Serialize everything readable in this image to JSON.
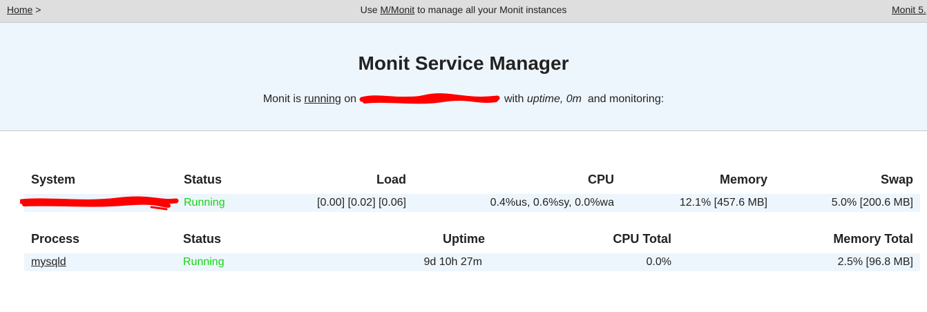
{
  "nav": {
    "home_label": "Home",
    "separator": ">",
    "center_prefix": "Use",
    "center_link": "M/Monit",
    "center_suffix": "to manage all your Monit instances",
    "version_link": "Monit 5."
  },
  "header": {
    "title": "Monit Service Manager",
    "status_prefix": "Monit is",
    "status_link": "running",
    "status_on": "on",
    "status_with": "with",
    "uptime_text": "uptime, 0m",
    "status_suffix": "and monitoring:"
  },
  "system_table": {
    "headers": {
      "system": "System",
      "status": "Status",
      "load": "Load",
      "cpu": "CPU",
      "memory": "Memory",
      "swap": "Swap"
    },
    "row": {
      "status": "Running",
      "load": "[0.00] [0.02] [0.06]",
      "cpu": "0.4%us, 0.6%sy, 0.0%wa",
      "memory": "12.1% [457.6 MB]",
      "swap": "5.0% [200.6 MB]"
    }
  },
  "process_table": {
    "headers": {
      "process": "Process",
      "status": "Status",
      "uptime": "Uptime",
      "cpu_total": "CPU Total",
      "memory_total": "Memory Total"
    },
    "rows": [
      {
        "name": "mysqld",
        "status": "Running",
        "uptime": "9d 10h 27m",
        "cpu_total": "0.0%",
        "memory_total": "2.5% [96.8 MB]"
      }
    ]
  },
  "colors": {
    "nav_bg": "#dedede",
    "header_bg": "#eef6fd",
    "running": "#11d611",
    "redaction": "#ff0000"
  }
}
